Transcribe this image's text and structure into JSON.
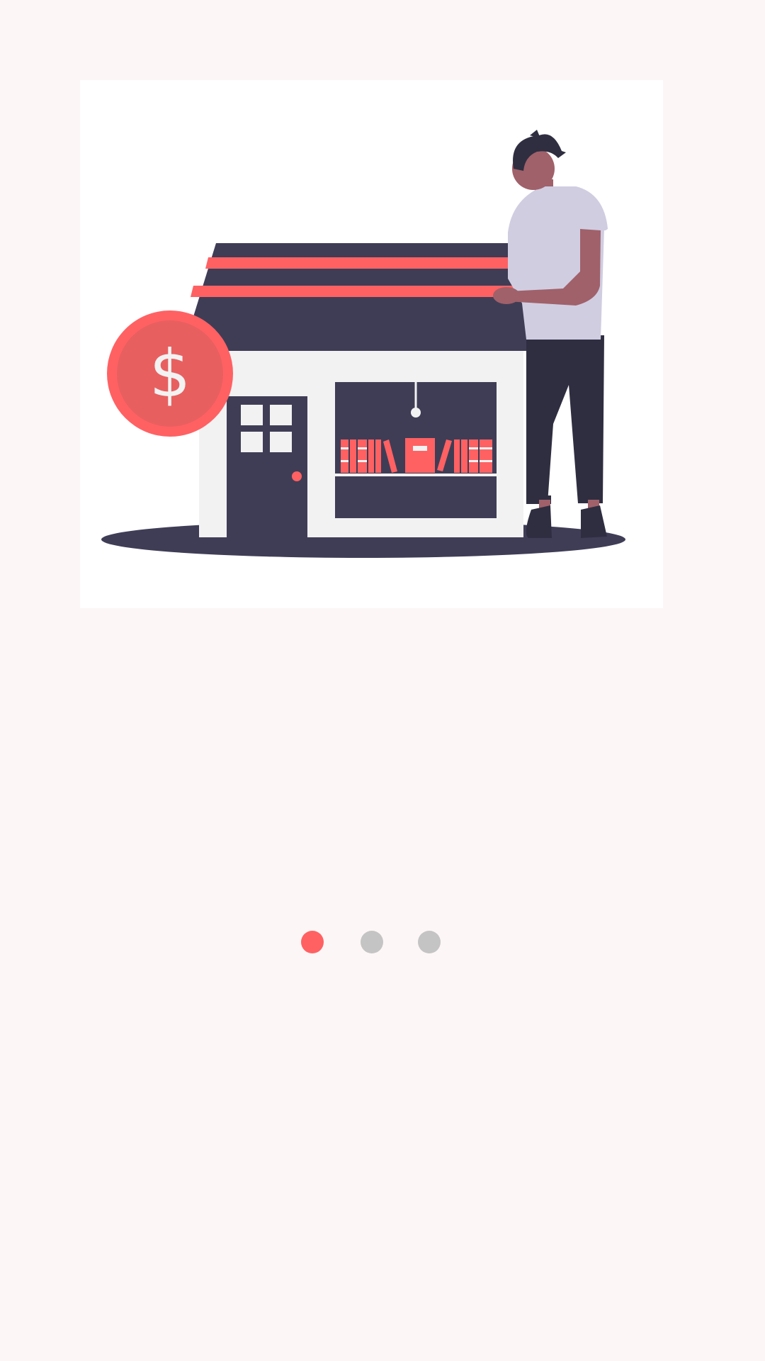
{
  "screen": {
    "background_color": "#fdf6f6",
    "illustration": {
      "name": "shop-owner-illustration",
      "coin_symbol": "$",
      "colors": {
        "accent": "#ff6163",
        "dark": "#3f3d56",
        "light": "#f2f2f2",
        "shirt": "#d0cde1",
        "skin": "#a0616a",
        "pants": "#2f2e41"
      }
    },
    "page_indicator": {
      "total_pages": 3,
      "active_page": 1,
      "active_color": "#ff6163",
      "inactive_color": "#c4c4c4"
    }
  }
}
